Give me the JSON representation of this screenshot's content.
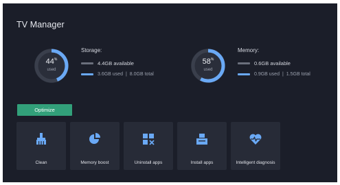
{
  "app": {
    "title": "TV Manager"
  },
  "storage": {
    "label": "Storage:",
    "percent": "44",
    "percent_unit": "%",
    "used_caption": "used",
    "fill_fraction": 0.44,
    "available_text": "4.4GB available",
    "used_text": "3.6GB used",
    "separator": "|",
    "total_text": "8.0GB total"
  },
  "memory": {
    "label": "Memory:",
    "percent": "58",
    "percent_unit": "%",
    "used_caption": "used",
    "fill_fraction": 0.58,
    "available_text": "0.6GB available",
    "used_text": "0.9GB used",
    "separator": "|",
    "total_text": "1.5GB total"
  },
  "actions": {
    "optimize_label": "Optimize"
  },
  "tools": [
    {
      "label": "Clean",
      "icon": "broom-icon"
    },
    {
      "label": "Memory boost",
      "icon": "pie-chart-icon"
    },
    {
      "label": "Uninstall apps",
      "icon": "uninstall-grid-icon"
    },
    {
      "label": "Install apps",
      "icon": "install-box-icon"
    },
    {
      "label": "Intelligent diagnosis",
      "icon": "heart-pulse-icon"
    }
  ],
  "colors": {
    "background": "#1b1e29",
    "tile": "#272b37",
    "accent_blue": "#6aa9f5",
    "button_green": "#32a07a",
    "ring_track": "#3a3f4c"
  }
}
